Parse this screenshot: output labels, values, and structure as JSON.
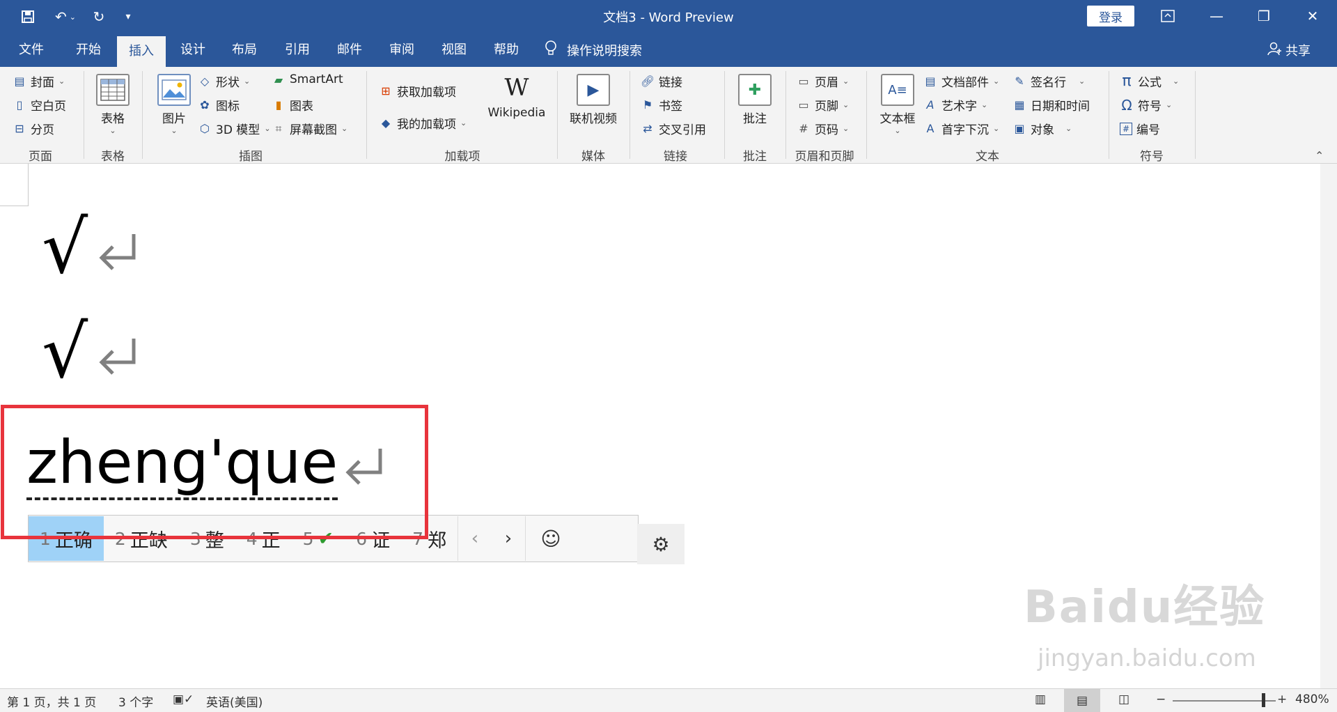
{
  "titlebar": {
    "doc_title": "文档3  -  Word Preview",
    "login_label": "登录",
    "save_icon": "save-icon",
    "undo_icon": "undo-icon",
    "redo_icon": "redo-icon"
  },
  "tabs": [
    "文件",
    "开始",
    "插入",
    "设计",
    "布局",
    "引用",
    "邮件",
    "审阅",
    "视图",
    "帮助"
  ],
  "active_tab": "插入",
  "tell_me": "操作说明搜索",
  "share": "共享",
  "ribbon": {
    "pages": {
      "cover": "封面",
      "blank": "空白页",
      "break": "分页",
      "label": "页面"
    },
    "tables": {
      "table": "表格",
      "label": "表格"
    },
    "illustrations": {
      "pictures": "图片",
      "shapes": "形状",
      "icons": "图标",
      "model3d": "3D 模型",
      "smartart": "SmartArt",
      "chart": "图表",
      "screenshot": "屏幕截图",
      "label": "插图"
    },
    "addins": {
      "get": "获取加载项",
      "mine": "我的加载项",
      "wikipedia": "Wikipedia",
      "label": "加载项"
    },
    "media": {
      "video": "联机视频",
      "label": "媒体"
    },
    "links": {
      "link": "链接",
      "bookmark": "书签",
      "crossref": "交叉引用",
      "label": "链接"
    },
    "comments": {
      "comment": "批注",
      "label": "批注"
    },
    "headerfooter": {
      "header": "页眉",
      "footer": "页脚",
      "pagenum": "页码",
      "label": "页眉和页脚"
    },
    "text": {
      "textbox": "文本框",
      "quickparts": "文档部件",
      "wordart": "艺术字",
      "dropcap": "首字下沉",
      "sigline": "签名行",
      "datetime": "日期和时间",
      "object": "对象",
      "label": "文本"
    },
    "symbols": {
      "equation": "公式",
      "symbol": "符号",
      "number": "编号",
      "label": "符号"
    }
  },
  "document": {
    "line1": "√",
    "line2": "√",
    "composition": "zheng'que"
  },
  "ime": {
    "candidates": [
      {
        "num": "1",
        "text": "正确"
      },
      {
        "num": "2",
        "text": "正缺"
      },
      {
        "num": "3",
        "text": "整"
      },
      {
        "num": "4",
        "text": "正"
      },
      {
        "num": "5",
        "text": "✔"
      },
      {
        "num": "6",
        "text": "证"
      },
      {
        "num": "7",
        "text": "郑"
      }
    ],
    "selected_index": 0
  },
  "statusbar": {
    "page": "第 1 页，共 1 页",
    "words": "3 个字",
    "language": "英语(美国)",
    "zoom": "480%"
  },
  "watermark": {
    "text": "Baidu经验",
    "url": "jingyan.baidu.com"
  },
  "colors": {
    "brand": "#2b579a",
    "highlight": "#e8343c",
    "candidate_selected": "#9fd2f7"
  }
}
